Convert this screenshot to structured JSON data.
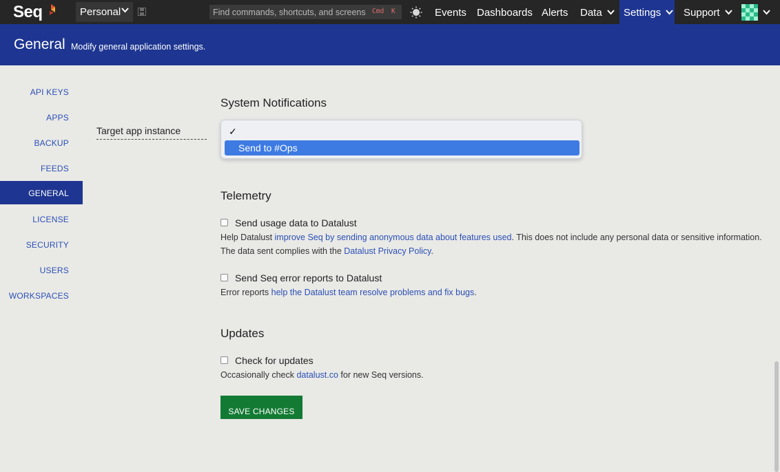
{
  "topnav": {
    "logo": "Seq",
    "workspace": "Personal",
    "search_placeholder": "Find commands, shortcuts, and screens",
    "kbd_cmd": "Cmd",
    "kbd_k": "K",
    "items": [
      {
        "label": "Events"
      },
      {
        "label": "Dashboards"
      },
      {
        "label": "Alerts"
      },
      {
        "label": "Data"
      },
      {
        "label": "Settings"
      },
      {
        "label": "Support"
      }
    ]
  },
  "header": {
    "title": "General",
    "subtitle": "Modify general application settings."
  },
  "sidebar": {
    "items": [
      {
        "label": "API KEYS"
      },
      {
        "label": "APPS"
      },
      {
        "label": "BACKUP"
      },
      {
        "label": "FEEDS"
      },
      {
        "label": "GENERAL"
      },
      {
        "label": "LICENSE"
      },
      {
        "label": "SECURITY"
      },
      {
        "label": "USERS"
      },
      {
        "label": "WORKSPACES"
      }
    ],
    "active": "GENERAL"
  },
  "notifications": {
    "title": "System Notifications",
    "field_label": "Target app instance",
    "dropdown": {
      "check": "✓",
      "option": "Send to #Ops"
    }
  },
  "telemetry": {
    "title": "Telemetry",
    "usage_label": "Send usage data to Datalust",
    "usage_help_pre": "Help Datalust ",
    "usage_help_link": "improve Seq by sending anonymous data about features used",
    "usage_help_mid": ". This does not include any personal data or sensitive information. The data sent complies with the ",
    "usage_help_link2": "Datalust Privacy Policy",
    "usage_help_post": ".",
    "errors_label": "Send Seq error reports to Datalust",
    "errors_help_pre": "Error reports ",
    "errors_help_link": "help the Datalust team resolve problems and fix bugs",
    "errors_help_post": "."
  },
  "updates": {
    "title": "Updates",
    "check_label": "Check for updates",
    "help_pre": "Occasionally check ",
    "help_link": "datalust.co",
    "help_post": " for new Seq versions."
  },
  "save_label": "SAVE CHANGES",
  "colors": {
    "nav_bg": "#262626",
    "brand_blue": "#1e3691",
    "link": "#2b50b5",
    "save_green": "#137a34",
    "selected_option": "#3d7be3"
  }
}
